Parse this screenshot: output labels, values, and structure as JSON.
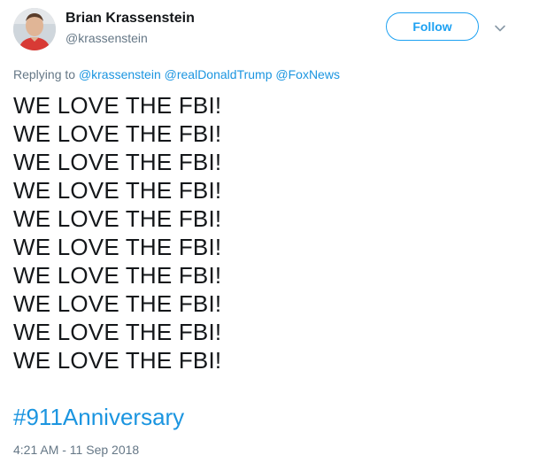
{
  "author": {
    "display_name": "Brian Krassenstein",
    "handle": "@krassenstein"
  },
  "follow_button": {
    "label": "Follow"
  },
  "reply_context": {
    "prefix": "Replying to",
    "mentions": [
      "@krassenstein",
      "@realDonaldTrump",
      "@FoxNews"
    ]
  },
  "tweet": {
    "lines": [
      "WE LOVE THE FBI!",
      "WE LOVE THE FBI!",
      "WE LOVE THE FBI!",
      "WE LOVE THE FBI!",
      "WE LOVE THE FBI!",
      "WE LOVE THE FBI!",
      "WE LOVE THE FBI!",
      "WE LOVE THE FBI!",
      "WE LOVE THE FBI!",
      "WE LOVE THE FBI!"
    ],
    "hashtag": "#911Anniversary",
    "timestamp": "4:21 AM - 11 Sep 2018"
  },
  "icons": {
    "avatar": "profile-photo",
    "menu": "chevron-down-icon"
  },
  "colors": {
    "link": "#1b95e0",
    "follow": "#1da1f2",
    "muted": "#657786",
    "text": "#14171a"
  }
}
